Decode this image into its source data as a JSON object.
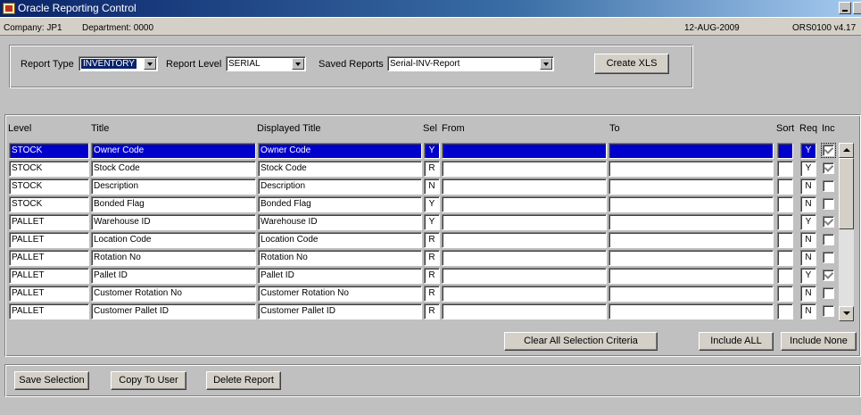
{
  "window": {
    "title": "Oracle Reporting Control"
  },
  "info": {
    "company": "Company: JP1",
    "department": "Department: 0000",
    "date": "12-AUG-2009",
    "version": "ORS0100  v4.17"
  },
  "filters": {
    "report_type_label": "Report Type",
    "report_type_value": "INVENTORY",
    "report_level_label": "Report Level",
    "report_level_value": "SERIAL",
    "saved_reports_label": "Saved Reports",
    "saved_reports_value": "Serial-INV-Report",
    "create_xls_label": "Create XLS"
  },
  "grid": {
    "headers": {
      "level": "Level",
      "title": "Title",
      "displayed_title": "Displayed Title",
      "sel": "Sel",
      "from": "From",
      "to": "To",
      "sort": "Sort",
      "req": "Req",
      "inc": "Inc"
    },
    "rows": [
      {
        "level": "STOCK",
        "title": "Owner Code",
        "displayed": "Owner Code",
        "sel": "Y",
        "from": "",
        "to": "",
        "sort": "",
        "req": "Y",
        "inc": true,
        "selected": true
      },
      {
        "level": "STOCK",
        "title": "Stock Code",
        "displayed": "Stock Code",
        "sel": "R",
        "from": "",
        "to": "",
        "sort": "",
        "req": "Y",
        "inc": true,
        "selected": false
      },
      {
        "level": "STOCK",
        "title": "Description",
        "displayed": "Description",
        "sel": "N",
        "from": "",
        "to": "",
        "sort": "",
        "req": "N",
        "inc": false,
        "selected": false
      },
      {
        "level": "STOCK",
        "title": "Bonded Flag",
        "displayed": "Bonded Flag",
        "sel": "Y",
        "from": "",
        "to": "",
        "sort": "",
        "req": "N",
        "inc": false,
        "selected": false
      },
      {
        "level": "PALLET",
        "title": "Warehouse ID",
        "displayed": "Warehouse ID",
        "sel": "Y",
        "from": "",
        "to": "",
        "sort": "",
        "req": "Y",
        "inc": true,
        "selected": false
      },
      {
        "level": "PALLET",
        "title": "Location Code",
        "displayed": "Location Code",
        "sel": "R",
        "from": "",
        "to": "",
        "sort": "",
        "req": "N",
        "inc": false,
        "selected": false
      },
      {
        "level": "PALLET",
        "title": "Rotation No",
        "displayed": "Rotation No",
        "sel": "R",
        "from": "",
        "to": "",
        "sort": "",
        "req": "N",
        "inc": false,
        "selected": false
      },
      {
        "level": "PALLET",
        "title": "Pallet ID",
        "displayed": "Pallet ID",
        "sel": "R",
        "from": "",
        "to": "",
        "sort": "",
        "req": "Y",
        "inc": true,
        "selected": false
      },
      {
        "level": "PALLET",
        "title": "Customer Rotation No",
        "displayed": "Customer Rotation No",
        "sel": "R",
        "from": "",
        "to": "",
        "sort": "",
        "req": "N",
        "inc": false,
        "selected": false
      },
      {
        "level": "PALLET",
        "title": "Customer Pallet ID",
        "displayed": "Customer Pallet ID",
        "sel": "R",
        "from": "",
        "to": "",
        "sort": "",
        "req": "N",
        "inc": false,
        "selected": false
      }
    ],
    "clear_label": "Clear All Selection Criteria",
    "include_all_label": "Include ALL",
    "include_none_label": "Include None"
  },
  "footer": {
    "save_label": "Save Selection",
    "copy_label": "Copy To User",
    "delete_label": "Delete Report"
  },
  "icons": {
    "app": "oracle-forms-icon",
    "minimize": "minimize-icon",
    "close": "close-icon"
  },
  "colors": {
    "title_bar": "#0a246a",
    "selected_row": "#0000cc",
    "window_bg": "#c0c0c0"
  }
}
